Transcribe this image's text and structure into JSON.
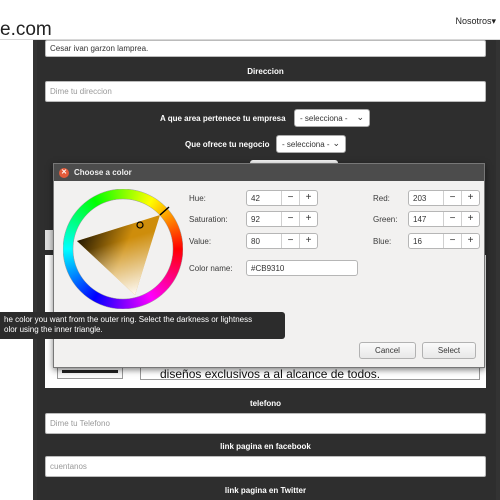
{
  "browser": {
    "url_fragment": "e.com",
    "nav_label": "Nosotros",
    "nav_caret": "▾"
  },
  "form": {
    "name_value": "Cesar ivan garzon lamprea.",
    "direccion_label": "Direccion",
    "direccion_placeholder": "Dime tu direccion",
    "area_label": "A que area pertenece tu empresa",
    "area_select": "- selecciona -",
    "negocio_label": "Que ofrece tu negocio",
    "negocio_select": "- selecciona -",
    "telefono_label": "telefono",
    "telefono_placeholder": "Dime tu Telefono",
    "facebook_label": "link pagina en facebook",
    "facebook_value": "cuentanos",
    "twitter_label": "link pagina en Twitter",
    "background_text": "diseños exclusivos a al alcance de todos."
  },
  "color_dialog": {
    "title": "Choose a color",
    "close_glyph": "✕",
    "fields": {
      "hue": {
        "label": "Hue:",
        "value": "42"
      },
      "saturation": {
        "label": "Saturation:",
        "value": "92"
      },
      "value": {
        "label": "Value:",
        "value": "80"
      },
      "red": {
        "label": "Red:",
        "value": "203"
      },
      "green": {
        "label": "Green:",
        "value": "147"
      },
      "blue": {
        "label": "Blue:",
        "value": "16"
      }
    },
    "minus": "−",
    "plus": "+",
    "color_name_label": "Color name:",
    "color_name_value": "#CB9310",
    "cancel_label": "Cancel",
    "select_label": "Select",
    "tooltip_line1": "he color you want from the outer ring. Select the darkness or lightness",
    "tooltip_line2": "olor using the inner triangle.",
    "current_hue_color": "#F2A60D",
    "selected_color": "#CB9310"
  }
}
